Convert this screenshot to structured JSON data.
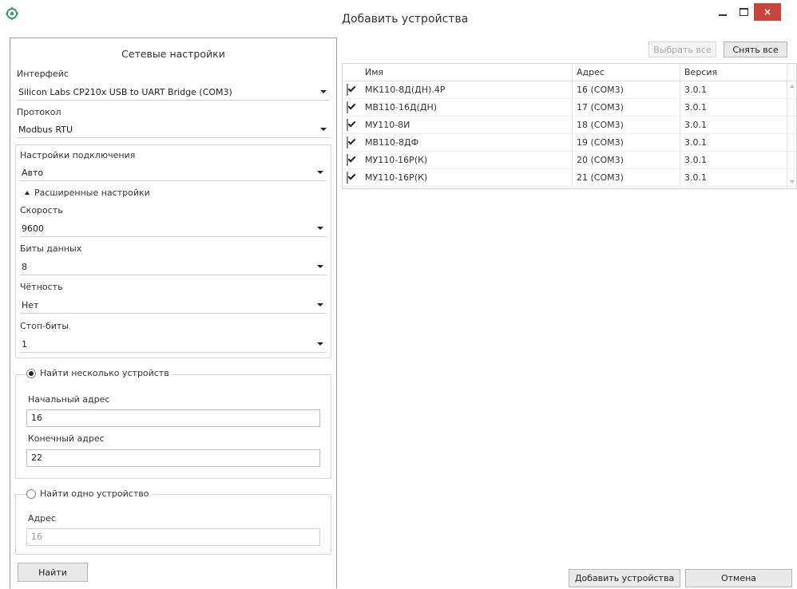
{
  "window": {
    "title": "Добавить устройства",
    "controls": {
      "close_glyph": "×"
    }
  },
  "left": {
    "header": "Сетевые настройки",
    "interface_label": "Интерфейс",
    "interface_value": "Silicon Labs CP210x USB to UART Bridge (COM3)",
    "protocol_label": "Протокол",
    "protocol_value": "Modbus RTU",
    "connection_label": "Настройки подключения",
    "connection_value": "Авто",
    "advanced_label": "Расширенные настройки",
    "speed_label": "Скорость",
    "speed_value": "9600",
    "databits_label": "Биты данных",
    "databits_value": "8",
    "parity_label": "Чётность",
    "parity_value": "Нет",
    "stopbits_label": "Стоп-биты",
    "stopbits_value": "1",
    "multi": {
      "label": "Найти несколько устройств",
      "start_label": "Начальный адрес",
      "start_value": "16",
      "end_label": "Конечный адрес",
      "end_value": "22"
    },
    "single": {
      "label": "Найти одно устройство",
      "addr_label": "Адрес",
      "addr_value": "16"
    },
    "find_button": "Найти"
  },
  "right": {
    "select_all": "Выбрать все",
    "deselect_all": "Снять все",
    "columns": [
      "Имя",
      "Адрес",
      "Версия"
    ],
    "rows": [
      {
        "name": "МК110-8Д(ДН).4Р",
        "addr": "16 (COM3)",
        "ver": "3.0.1"
      },
      {
        "name": "МВ110-16Д(ДН)",
        "addr": "17 (COM3)",
        "ver": "3.0.1"
      },
      {
        "name": "МУ110-8И",
        "addr": "18 (COM3)",
        "ver": "3.0.1"
      },
      {
        "name": "МВ110-8ДФ",
        "addr": "19 (COM3)",
        "ver": "3.0.1"
      },
      {
        "name": "МУ110-16Р(К)",
        "addr": "20 (COM3)",
        "ver": "3.0.1"
      },
      {
        "name": "МУ110-16Р(К)",
        "addr": "21 (COM3)",
        "ver": "3.0.1"
      }
    ],
    "add_button": "Добавить устройства",
    "cancel_button": "Отмена"
  },
  "colors": {
    "close": "#c9443a",
    "panel_border": "#8fa3b8",
    "app_icon": "#3a9b6a"
  },
  "icons": [
    "app-icon",
    "chevron-down-icon",
    "collapse-triangle-icon",
    "checkbox-icon",
    "minimize-icon",
    "maximize-icon",
    "close-icon"
  ]
}
